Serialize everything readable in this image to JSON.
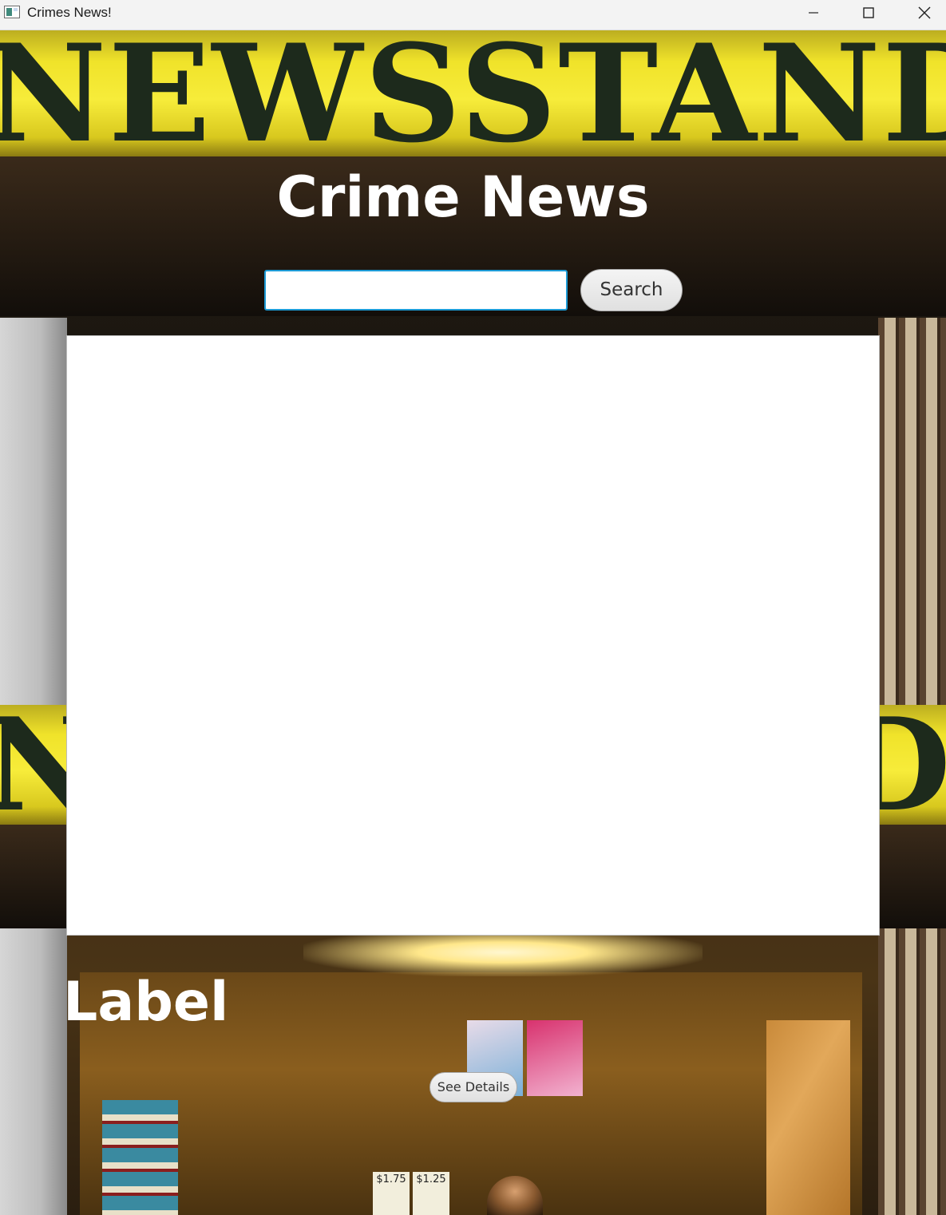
{
  "window": {
    "title": "Crimes News!"
  },
  "background": {
    "sign_text": "NEWSSTAND",
    "price_tags": [
      "$1.75",
      "$1.25"
    ]
  },
  "header": {
    "title": "Crime News"
  },
  "search": {
    "value": "",
    "placeholder": "",
    "button_label": "Search"
  },
  "results": {
    "items": []
  },
  "detail": {
    "label": "Label",
    "button_label": "See Details"
  },
  "colors": {
    "input_focus_border": "#1d9bd6",
    "sign_yellow": "#f7ec3a",
    "title_text": "#ffffff"
  }
}
